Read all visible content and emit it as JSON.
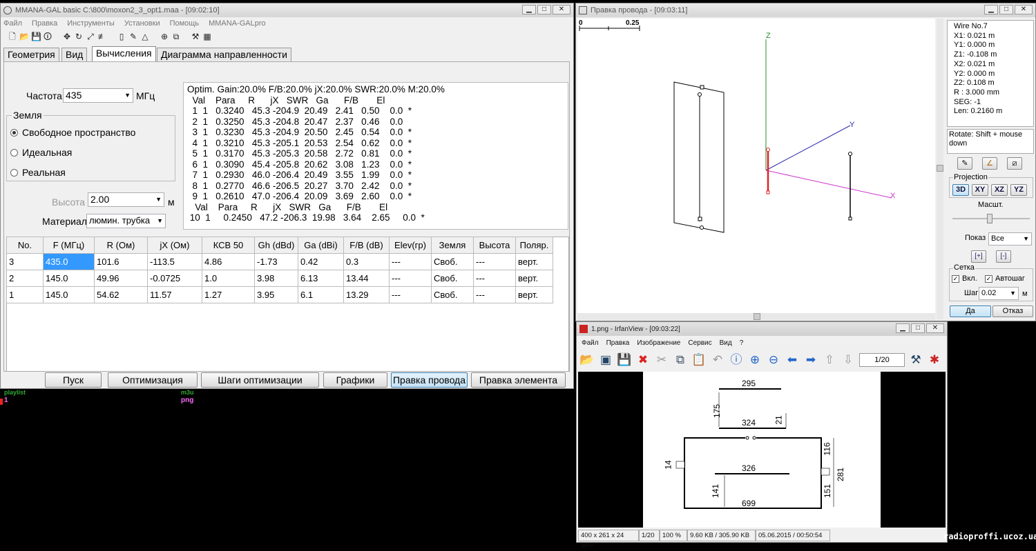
{
  "main_window": {
    "title": "MMANA-GAL basic C:\\800\\moxon2_3_opt1.maa - [09:02:10]",
    "menu": [
      "Файл",
      "Правка",
      "Инструменты",
      "Установки",
      "Помощь",
      "MMANA-GALpro"
    ],
    "tabs": [
      "Геометрия",
      "Вид",
      "Вычисления",
      "Диаграмма направленности"
    ],
    "active_tab": "Вычисления",
    "freq_label": "Частота",
    "freq_value": "435",
    "freq_unit": "МГц",
    "ground_label": "Земля",
    "ground_options": [
      "Свободное пространство",
      "Идеальная",
      "Реальная"
    ],
    "height_label": "Высота",
    "height_value": "2.00",
    "height_unit": "м",
    "material_label": "Материал",
    "material_value": "люмин. трубка",
    "optim_lines": [
      "Optim. Gain:20.0% F/B:20.0% jX:20.0% SWR:20.0% M:20.0%",
      "  Val    Para     R      jX   SWR   Ga      F/B       El",
      "  1  1   0.3240   45.3 -204.9  20.49   2.41   0.50    0.0  *",
      "  2  1   0.3250   45.3 -204.8  20.47   2.37   0.46    0.0",
      "  3  1   0.3230   45.3 -204.9  20.50   2.45   0.54    0.0  *",
      "  4  1   0.3210   45.3 -205.1  20.53   2.54   0.62    0.0  *",
      "  5  1   0.3170   45.3 -205.3  20.58   2.72   0.81    0.0  *",
      "  6  1   0.3090   45.4 -205.8  20.62   3.08   1.23    0.0  *",
      "  7  1   0.2930   46.0 -206.4  20.49   3.55   1.99    0.0  *",
      "  8  1   0.2770   46.6 -206.5  20.27   3.70   2.42    0.0  *",
      "  9  1   0.2610   47.0 -206.4  20.09   3.69   2.60    0.0  *",
      "   Val    Para     R      jX   SWR   Ga      F/B       El",
      " 10  1     0.2450   47.2 -206.3  19.98   3.64    2.65     0.0  *"
    ],
    "table_headers": [
      "No.",
      "F (МГц)",
      "R (Ом)",
      "jX (Ом)",
      "КСВ 50",
      "Gh (dBd)",
      "Ga (dBi)",
      "F/B (dB)",
      "Elev(гр)",
      "Земля",
      "Высота",
      "Поляр."
    ],
    "table_rows": [
      [
        "3",
        "435.0",
        "101.6",
        "-113.5",
        "4.86",
        "-1.73",
        "0.42",
        "0.3",
        "---",
        "Своб.",
        "---",
        "верт."
      ],
      [
        "2",
        "145.0",
        "49.96",
        "-0.0725",
        "1.0",
        "3.98",
        "6.13",
        "13.44",
        "---",
        "Своб.",
        "---",
        "верт."
      ],
      [
        "1",
        "145.0",
        "54.62",
        "11.57",
        "1.27",
        "3.95",
        "6.1",
        "13.29",
        "---",
        "Своб.",
        "---",
        "верт."
      ]
    ],
    "buttons": [
      "Пуск",
      "Оптимизация",
      "Шаги оптимизации",
      "Графики",
      "Правка провода",
      "Правка элемента"
    ]
  },
  "bg_text": {
    "a": "playlist",
    "b": "m3u",
    "c": "1",
    "d": "png"
  },
  "wire_window": {
    "title": "Правка провода - [09:03:11]",
    "scale_start": "0",
    "scale_end": "0.25",
    "axis_z": "Z",
    "axis_y": "Y",
    "axis_x": "X",
    "info": [
      "Wire No.7",
      "X1: 0.021 m",
      "Y1: 0.000 m",
      "Z1: -0.108 m",
      "X2: 0.021 m",
      "Y2: 0.000 m",
      "Z2: 0.108 m",
      "R : 3.000 mm",
      "SEG: -1",
      "Len: 0.2160 m"
    ],
    "rotate_hint": "Rotate: Shift + mouse down",
    "projection_label": "Projection",
    "proj_buttons": [
      "3D",
      "XY",
      "XZ",
      "YZ"
    ],
    "scale_label": "Масшт.",
    "show_label": "Показ",
    "show_value": "Все",
    "grid_label": "Сетка",
    "grid_on": "Вкл.",
    "autostep": "Автошаг",
    "step_label": "Шаг",
    "step_value": "0.02",
    "step_unit": "м",
    "ok": "Да",
    "cancel": "Отказ"
  },
  "irfan": {
    "title": "1.png - IrfanView - [09:03:22]",
    "menu": [
      "Файл",
      "Правка",
      "Изображение",
      "Сервис",
      "Вид",
      "?"
    ],
    "page": "1/20",
    "dims": [
      "295",
      "175",
      "324",
      "21",
      "116",
      "14",
      "326",
      "281",
      "141",
      "151",
      "699"
    ],
    "status": [
      "400 x 261 x 24 BPP",
      "1/20",
      "100 %",
      "9.60 KB / 305.90 KB",
      "05.06.2015 / 00:50:54"
    ]
  },
  "watermark": "radioproffi.ucoz.ua",
  "colors": {
    "z_axis": "#2a8a2a",
    "y_axis": "#2a2aaa",
    "x_axis": "#cc33cc",
    "active_wire": "#dd2222",
    "selection": "#3399ff"
  }
}
